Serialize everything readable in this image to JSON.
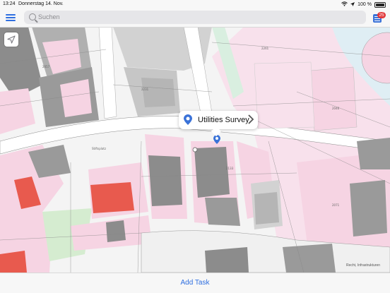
{
  "status_bar": {
    "time": "13:24",
    "date": "Donnerstag 14. Nov.",
    "battery": "100 %"
  },
  "search": {
    "placeholder": "Suchen"
  },
  "tasks": {
    "badge_count": "25"
  },
  "map": {
    "callout": {
      "title": "Utilities Survey"
    },
    "street_labels": [
      "Stiftsplatz"
    ],
    "attribution": "Recht, Infrastrukturen"
  },
  "bottom": {
    "add_task_label": "Add Task"
  },
  "colors": {
    "accent": "#2f6fe0",
    "badge": "#e0383b",
    "building_pink": "#f6d4e3",
    "building_gray": "#8c8c8c",
    "building_red": "#e85a4e",
    "green_area": "#d5ecd0",
    "map_pin": "#3a72d8"
  }
}
